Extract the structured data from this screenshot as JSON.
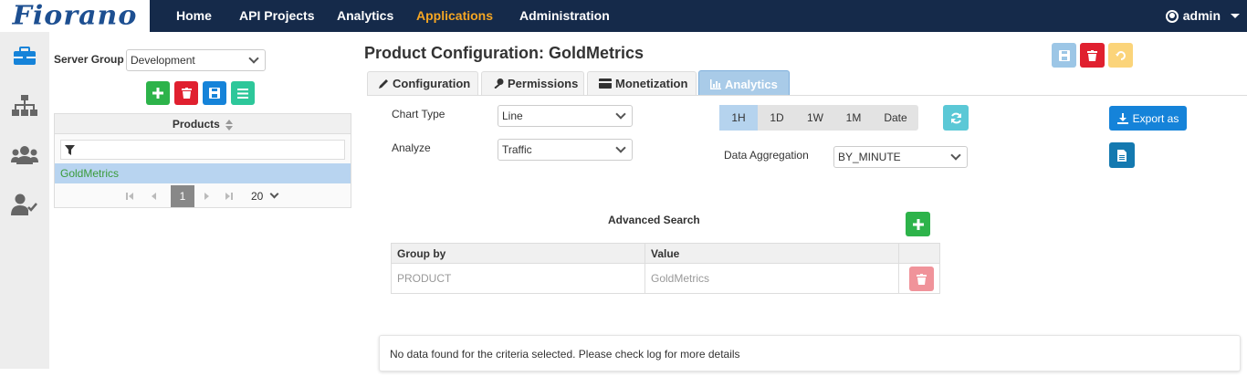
{
  "brand": {
    "logo_text": "Fiorano"
  },
  "nav": {
    "items": [
      {
        "label": "Home"
      },
      {
        "label": "API Projects"
      },
      {
        "label": "Analytics"
      },
      {
        "label": "Applications",
        "active": true
      },
      {
        "label": "Administration"
      }
    ],
    "user": "admin"
  },
  "sidebar": {
    "icons": [
      "briefcase-icon",
      "sitemap-icon",
      "users-icon",
      "user-check-icon"
    ]
  },
  "left_panel": {
    "server_group_label": "Server Group",
    "server_group_value": "Development",
    "products_header": "Products",
    "products": [
      "GoldMetrics"
    ],
    "pager": {
      "current_page": "1",
      "page_size": "20"
    }
  },
  "main": {
    "title": "Product Configuration: GoldMetrics",
    "tabs": [
      {
        "label": "Configuration"
      },
      {
        "label": "Permissions"
      },
      {
        "label": "Monetization"
      },
      {
        "label": "Analytics",
        "active": true
      }
    ],
    "chart_type_label": "Chart Type",
    "chart_type_value": "Line",
    "analyze_label": "Analyze",
    "analyze_value": "Traffic",
    "time_ranges": [
      "1H",
      "1D",
      "1W",
      "1M",
      "Date"
    ],
    "time_range_selected": "1H",
    "data_aggregation_label": "Data Aggregation",
    "data_aggregation_value": "BY_MINUTE",
    "export_label": "Export as",
    "advanced_search_title": "Advanced Search",
    "advanced_table": {
      "headers": [
        "Group by",
        "Value"
      ],
      "rows": [
        {
          "group_by": "PRODUCT",
          "value": "GoldMetrics"
        }
      ]
    },
    "message": "No data found for the criteria selected. Please check log for more details"
  },
  "colors": {
    "nav_bg": "#152a4a",
    "nav_active": "#f5a623",
    "green": "#2db34a",
    "red": "#e0202f",
    "blue": "#1583d9",
    "teal": "#2dc79a"
  }
}
